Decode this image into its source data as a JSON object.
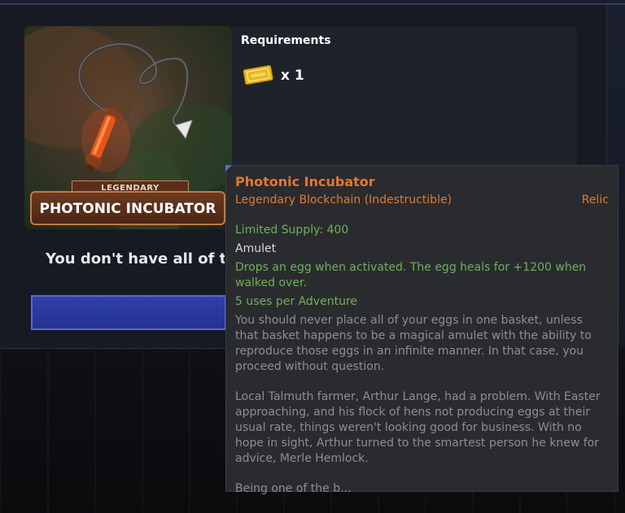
{
  "item_card": {
    "rarity": "LEGENDARY",
    "name": "PHOTONIC INCUBATOR"
  },
  "requirements": {
    "title": "Requirements",
    "items": [
      {
        "icon": "golden-ticket-icon",
        "quantity": "x 1"
      }
    ]
  },
  "notice": "You don't have all of th",
  "tooltip": {
    "name": "Photonic Incubator",
    "subtitle": "Legendary Blockchain (Indestructible)",
    "category": "Relic",
    "supply": "Limited Supply: 400",
    "slot": "Amulet",
    "effect": "Drops an egg when activated. The egg heals for +1200 when walked over.",
    "uses": "5 uses per Adventure",
    "lore_1": "You should never place all of your eggs in one basket, unless that basket happens to be a magical amulet with the ability to reproduce those eggs in an infinite manner. In that case, you proceed without question.",
    "lore_2": "Local Talmuth farmer, Arthur Lange, had a problem. With Easter approaching, and his flock of hens not producing eggs at their usual rate, things weren't looking good for business. With no hope in sight, Arthur turned to the smartest person he knew for advice, Merle Hemlock.",
    "lore_3": "Being one of the b..."
  },
  "colors": {
    "legendary_orange": "#e2782f",
    "stat_green": "#6fb05a",
    "button_blue": "#2f40a9"
  }
}
